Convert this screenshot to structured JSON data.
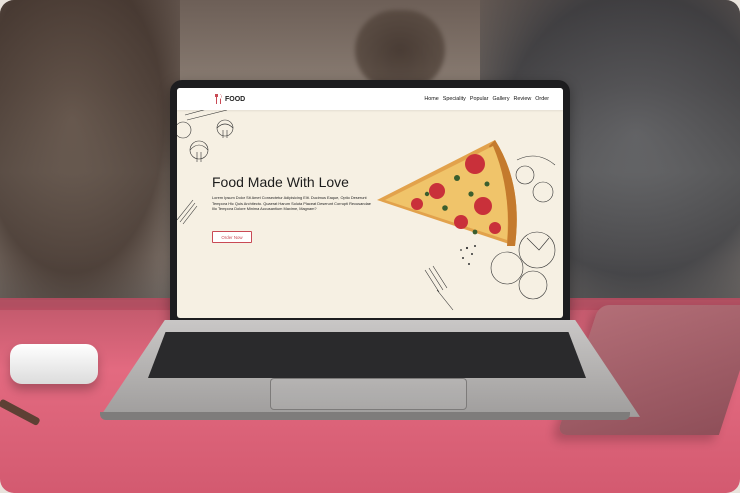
{
  "nav": {
    "brand": "FOOD",
    "items": [
      "Home",
      "Speciality",
      "Popular",
      "Gallery",
      "Review",
      "Order"
    ]
  },
  "hero": {
    "title": "Food Made With Love",
    "description": "Lorem Ipsum Dolor Sit Amet Consectetur Adipisicing Elit. Ducimus Eaque, Optio Deserunt Tempora Hic Quis Architecto. Quaerat Harum Soluta Placeat Deserunt Corrupti Recusandae Illo Tempora Dolore Minima Accusantium Maxime, Magnam?",
    "button": "Order Now"
  },
  "colors": {
    "accent": "#c94a55",
    "screen_bg": "#f6f0e3",
    "table": "#e36a80"
  },
  "icons": [
    "fork-knife-icon",
    "pizza-slice-image",
    "mushroom-sketch",
    "tomato-sketch",
    "fork-sketch"
  ]
}
